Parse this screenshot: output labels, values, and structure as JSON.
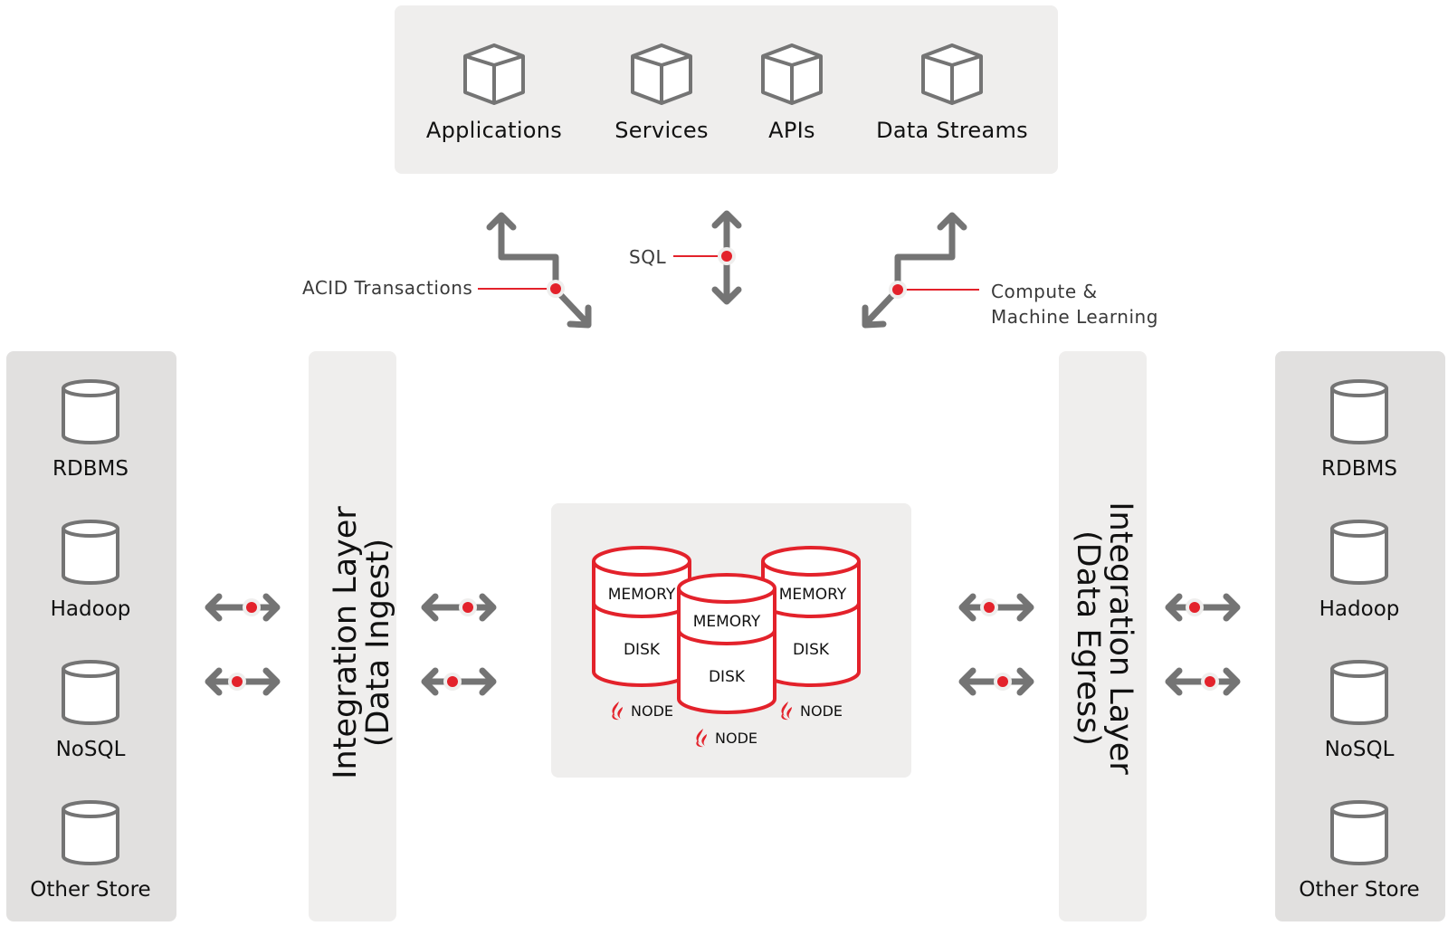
{
  "top_panel": {
    "items": [
      {
        "label": "Applications",
        "icon": "box-icon"
      },
      {
        "label": "Services",
        "icon": "box-icon"
      },
      {
        "label": "APIs",
        "icon": "box-icon"
      },
      {
        "label": "Data Streams",
        "icon": "box-icon"
      }
    ]
  },
  "connectors": {
    "acid": "ACID Transactions",
    "sql": "SQL",
    "compute_line1": "Compute &",
    "compute_line2": "Machine Learning"
  },
  "left_stores": {
    "items": [
      {
        "label": "RDBMS",
        "icon": "database-icon"
      },
      {
        "label": "Hadoop",
        "icon": "database-icon"
      },
      {
        "label": "NoSQL",
        "icon": "database-icon"
      },
      {
        "label": "Other Store",
        "icon": "database-icon"
      }
    ]
  },
  "right_stores": {
    "items": [
      {
        "label": "RDBMS",
        "icon": "database-icon"
      },
      {
        "label": "Hadoop",
        "icon": "database-icon"
      },
      {
        "label": "NoSQL",
        "icon": "database-icon"
      },
      {
        "label": "Other Store",
        "icon": "database-icon"
      }
    ]
  },
  "integration_ingest": {
    "line1": "Integration Layer",
    "line2": "(Data Ingest)"
  },
  "integration_egress": {
    "line1": "Integration Layer",
    "line2": "(Data Egress)"
  },
  "cluster": {
    "nodes": [
      {
        "memory": "MEMORY",
        "disk": "DISK",
        "label": "NODE"
      },
      {
        "memory": "MEMORY",
        "disk": "DISK",
        "label": "NODE"
      },
      {
        "memory": "MEMORY",
        "disk": "DISK",
        "label": "NODE"
      }
    ]
  },
  "colors": {
    "accent_red": "#e3222b",
    "arrow_gray": "#747474",
    "panel_light": "#efeeed",
    "panel_dark": "#e1e0df"
  }
}
